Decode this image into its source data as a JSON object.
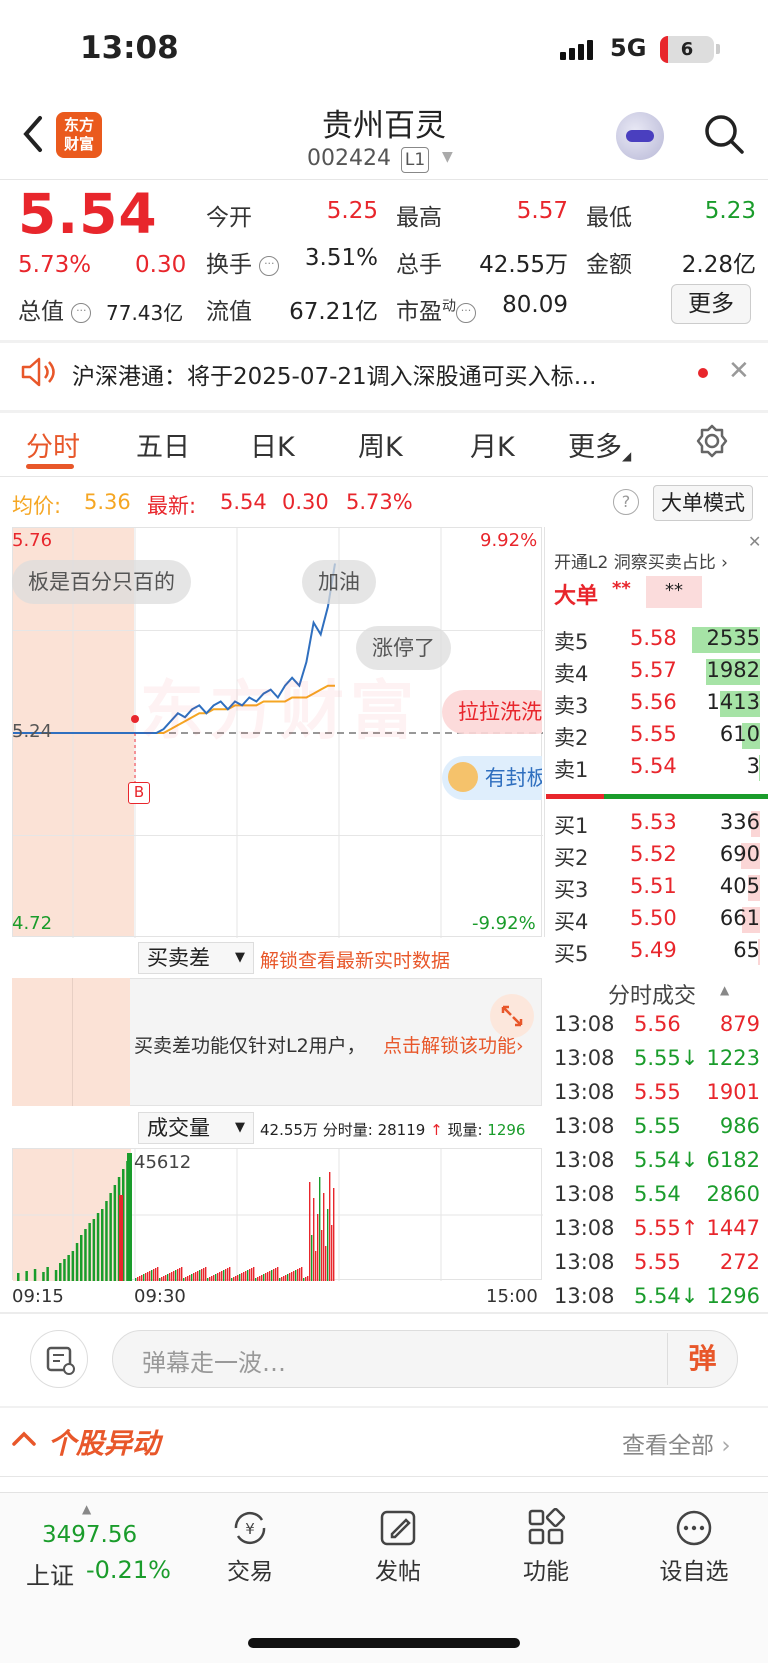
{
  "status_bar": {
    "time": "13:08",
    "network": "5G",
    "battery": "6"
  },
  "header": {
    "logo_line1": "东方",
    "logo_line2": "财富",
    "stock_name": "贵州百灵",
    "stock_code": "002424",
    "level_badge": "L1"
  },
  "quote": {
    "price": "5.54",
    "change_pct": "5.73%",
    "change": "0.30",
    "open_label": "今开",
    "open": "5.25",
    "high_label": "最高",
    "high": "5.57",
    "low_label": "最低",
    "low": "5.23",
    "turnover_label": "换手",
    "turnover": "3.51%",
    "volume_label": "总手",
    "volume": "42.55万",
    "amount_label": "金额",
    "amount": "2.28亿",
    "mktcap_label": "总值",
    "mktcap": "77.43亿",
    "float_label": "流值",
    "float_cap": "67.21亿",
    "pe_label": "市盈",
    "pe_sup": "动",
    "pe": "80.09",
    "more_button": "更多"
  },
  "notice": {
    "text": "沪深港通：将于2025-07-21调入深股通可买入标…"
  },
  "tabs": [
    "分时",
    "五日",
    "日K",
    "周K",
    "月K",
    "更多"
  ],
  "info_row": {
    "avg_label": "均价:",
    "avg": "5.36",
    "latest_label": "最新:",
    "latest": "5.54",
    "latest_chg": "0.30",
    "latest_pct": "5.73%",
    "mode_button": "大单模式"
  },
  "chart": {
    "y_top": "5.76",
    "y_mid": "5.24",
    "y_bottom": "4.72",
    "pct_top": "9.92%",
    "pct_bottom": "-9.92%",
    "marker": "B",
    "watermark": "东方财富",
    "bubbles": [
      "板是百分只百的",
      "加油",
      "涨停了",
      "拉拉洗洗",
      "有封板"
    ]
  },
  "chart_data": {
    "type": "line",
    "x_labels": [
      "09:15",
      "09:30",
      "15:00"
    ],
    "ylim": [
      4.72,
      5.76
    ],
    "prev_close": 5.24,
    "series": [
      {
        "name": "最新",
        "color": "#2f6fbf",
        "values": [
          5.24,
          5.24,
          5.24,
          5.24,
          5.25,
          5.27,
          5.29,
          5.28,
          5.3,
          5.31,
          5.29,
          5.31,
          5.32,
          5.3,
          5.32,
          5.31,
          5.33,
          5.32,
          5.34,
          5.35,
          5.33,
          5.36,
          5.38,
          5.36,
          5.42,
          5.52,
          5.49,
          5.56,
          5.67
        ]
      },
      {
        "name": "均价",
        "color": "#f5a623",
        "values": [
          5.24,
          5.24,
          5.24,
          5.24,
          5.24,
          5.25,
          5.26,
          5.27,
          5.28,
          5.29,
          5.29,
          5.3,
          5.3,
          5.3,
          5.31,
          5.31,
          5.31,
          5.31,
          5.32,
          5.32,
          5.32,
          5.32,
          5.33,
          5.33,
          5.33,
          5.34,
          5.35,
          5.36,
          5.36
        ]
      }
    ]
  },
  "order_book": {
    "header": "开通L2 洞察买卖占比",
    "big_order_label": "大单",
    "big_order_red": "**",
    "big_order_green": "**",
    "asks": [
      {
        "label": "卖5",
        "price": "5.58",
        "qty": "2535",
        "fill": 0.95
      },
      {
        "label": "卖4",
        "price": "5.57",
        "qty": "1982",
        "fill": 0.75
      },
      {
        "label": "卖3",
        "price": "5.56",
        "qty": "1413",
        "fill": 0.55
      },
      {
        "label": "卖2",
        "price": "5.55",
        "qty": "610",
        "fill": 0.25
      },
      {
        "label": "卖1",
        "price": "5.54",
        "qty": "3",
        "fill": 0.02
      }
    ],
    "bids": [
      {
        "label": "买1",
        "price": "5.53",
        "qty": "336",
        "fill": 0.12
      },
      {
        "label": "买2",
        "price": "5.52",
        "qty": "690",
        "fill": 0.26
      },
      {
        "label": "买3",
        "price": "5.51",
        "qty": "405",
        "fill": 0.16
      },
      {
        "label": "买4",
        "price": "5.50",
        "qty": "661",
        "fill": 0.25
      },
      {
        "label": "买5",
        "price": "5.49",
        "qty": "65",
        "fill": 0.03
      }
    ]
  },
  "trades": {
    "title": "分时成交",
    "rows": [
      {
        "time": "13:08",
        "price": "5.56",
        "vol": "879",
        "color": "red"
      },
      {
        "time": "13:08",
        "price": "5.55↓",
        "vol": "1223",
        "color": "green"
      },
      {
        "time": "13:08",
        "price": "5.55",
        "vol": "1901",
        "color": "red"
      },
      {
        "time": "13:08",
        "price": "5.55",
        "vol": "986",
        "color": "green"
      },
      {
        "time": "13:08",
        "price": "5.54↓",
        "vol": "6182",
        "color": "green"
      },
      {
        "time": "13:08",
        "price": "5.54",
        "vol": "2860",
        "color": "green"
      },
      {
        "time": "13:08",
        "price": "5.55↑",
        "vol": "1447",
        "color": "red"
      },
      {
        "time": "13:08",
        "price": "5.55",
        "vol": "272",
        "color": "red"
      },
      {
        "time": "13:08",
        "price": "5.54↓",
        "vol": "1296",
        "color": "green"
      }
    ]
  },
  "buy_sell_diff": {
    "selector": "买卖差",
    "unlock": "解锁查看最新实时数据",
    "panel_text": "买卖差功能仅针对L2用户，",
    "panel_link": "点击解锁该功能"
  },
  "volume": {
    "selector": "成交量",
    "total": "42.55万",
    "minute_label": "分时量:",
    "minute": "28119",
    "current_label": "现量:",
    "current": "1296",
    "peak_label": "45612",
    "times": [
      "09:15",
      "09:30",
      "15:00"
    ]
  },
  "danmu": {
    "placeholder": "弹幕走一波…",
    "send": "弹"
  },
  "section": {
    "title": "个股异动",
    "view_all": "查看全部"
  },
  "bottom_nav": {
    "index_value": "3497.56",
    "index_name": "上证",
    "index_chg": "-0.21%",
    "items": [
      "交易",
      "发帖",
      "功能",
      "设自选"
    ]
  }
}
